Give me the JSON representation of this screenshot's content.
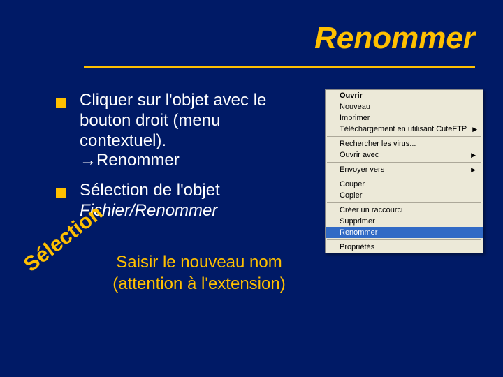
{
  "title": "Renommer",
  "bullets": [
    {
      "main": "Cliquer sur l'objet avec le bouton droit (menu contextuel).",
      "arrow": "→Renommer"
    },
    {
      "main": "Sélection de l'objet",
      "italic": "Fichier/Renommer"
    }
  ],
  "badge": "Sélection",
  "footer": "Saisir le nouveau nom (attention à l'extension)",
  "menu": {
    "groups": [
      [
        {
          "label": "Ouvrir",
          "bold": true
        },
        {
          "label": "Nouveau"
        },
        {
          "label": "Imprimer"
        },
        {
          "label": "Téléchargement en utilisant CuteFTP",
          "submenu": true
        }
      ],
      [
        {
          "label": "Rechercher les virus..."
        },
        {
          "label": "Ouvrir avec",
          "submenu": true
        }
      ],
      [
        {
          "label": "Envoyer vers",
          "submenu": true
        }
      ],
      [
        {
          "label": "Couper"
        },
        {
          "label": "Copier"
        }
      ],
      [
        {
          "label": "Créer un raccourci"
        },
        {
          "label": "Supprimer"
        },
        {
          "label": "Renommer",
          "selected": true
        }
      ],
      [
        {
          "label": "Propriétés"
        }
      ]
    ]
  }
}
